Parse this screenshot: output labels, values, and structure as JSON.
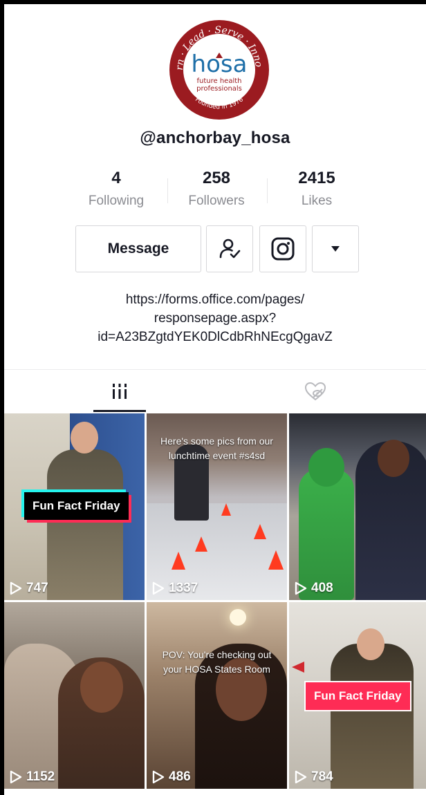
{
  "profile": {
    "logo_text": {
      "top_words": [
        "Learn",
        "Lead",
        "Serve",
        "Innovate"
      ],
      "brand": "hosa",
      "tagline_1": "future health",
      "tagline_2": "professionals",
      "founded": "Founded in 1976"
    },
    "username": "@anchorbay_hosa",
    "stats": [
      {
        "value": "4",
        "label": "Following"
      },
      {
        "value": "258",
        "label": "Followers"
      },
      {
        "value": "2415",
        "label": "Likes"
      }
    ],
    "actions": {
      "message_label": "Message",
      "follow_icon": "user-check-icon",
      "instagram_icon": "instagram-icon",
      "more_icon": "caret-down-icon"
    },
    "bio_lines": [
      "https://forms.office.com/pages/",
      "responsepage.aspx?",
      "id=A23BZgtdYEK0DlCdbRhNEcgQgavZ"
    ]
  },
  "tabs": [
    {
      "name": "videos",
      "icon": "grid-bars-icon",
      "active": true
    },
    {
      "name": "liked",
      "icon": "heart-hidden-icon",
      "active": false
    }
  ],
  "videos": [
    {
      "views": "747",
      "overlay": "Fun Fact Friday",
      "caption": ""
    },
    {
      "views": "1337",
      "overlay": "",
      "caption": "Here's some pics from our lunchtime event #s4sd"
    },
    {
      "views": "408",
      "overlay": "",
      "caption": ""
    },
    {
      "views": "1152",
      "overlay": "",
      "caption": ""
    },
    {
      "views": "486",
      "overlay": "",
      "caption": "POV: You're checking out your HOSA States Room"
    },
    {
      "views": "784",
      "overlay": "Fun Fact Friday",
      "caption": ""
    }
  ],
  "colors": {
    "text": "#161823",
    "muted": "#8a8b91",
    "border": "#d6d6d9",
    "logo_red": "#9b1b20",
    "logo_blue": "#1e6fa8",
    "fff_pink": "#fe2c55",
    "fff_cyan": "#25f4ee"
  }
}
